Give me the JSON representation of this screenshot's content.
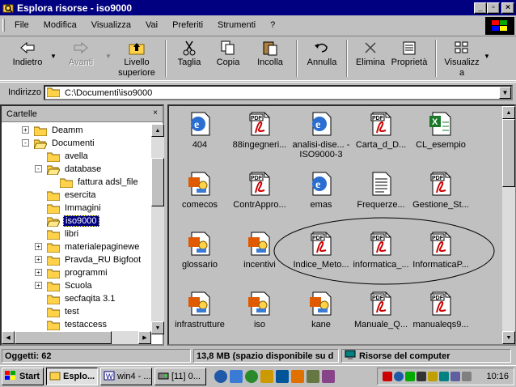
{
  "window": {
    "title": "Esplora risorse - iso9000"
  },
  "menu": [
    "File",
    "Modifica",
    "Visualizza",
    "Vai",
    "Preferiti",
    "Strumenti",
    "?"
  ],
  "toolbar": {
    "back": "Indietro",
    "forward": "Avanti",
    "up_line1": "Livello",
    "up_line2": "superiore",
    "cut": "Taglia",
    "copy": "Copia",
    "paste": "Incolla",
    "undo": "Annulla",
    "delete": "Elimina",
    "properties": "Proprietà",
    "views_line1": "Visualizz",
    "views_line2": "a"
  },
  "address": {
    "label": "Indirizzo",
    "value": "C:\\Documenti\\iso9000"
  },
  "folders_pane": {
    "title": "Cartelle",
    "close": "×"
  },
  "tree": [
    {
      "label": "Deamm",
      "level": 2,
      "expander": "+"
    },
    {
      "label": "Documenti",
      "level": 2,
      "expander": "-"
    },
    {
      "label": "avella",
      "level": 3,
      "expander": ""
    },
    {
      "label": "database",
      "level": 3,
      "expander": "-"
    },
    {
      "label": "fattura adsl_file",
      "level": 4,
      "expander": ""
    },
    {
      "label": "esercita",
      "level": 3,
      "expander": ""
    },
    {
      "label": "Immagini",
      "level": 3,
      "expander": ""
    },
    {
      "label": "iso9000",
      "level": 3,
      "expander": "",
      "selected": true
    },
    {
      "label": "libri",
      "level": 3,
      "expander": ""
    },
    {
      "label": "materialepaginewe",
      "level": 3,
      "expander": "+"
    },
    {
      "label": "Pravda_RU Bigfoot",
      "level": 3,
      "expander": "+"
    },
    {
      "label": "programmi",
      "level": 3,
      "expander": "+"
    },
    {
      "label": "Scuola",
      "level": 3,
      "expander": "+"
    },
    {
      "label": "secfaqita 3.1",
      "level": 3,
      "expander": ""
    },
    {
      "label": "test",
      "level": 3,
      "expander": ""
    },
    {
      "label": "testaccess",
      "level": 3,
      "expander": ""
    }
  ],
  "files": [
    {
      "name": "404",
      "icon": "ie-html-icon"
    },
    {
      "name": "88ingegneri...",
      "icon": "pdf-icon"
    },
    {
      "name": "analisi-dise... - ISO9000-3",
      "icon": "ie-html-icon"
    },
    {
      "name": "Carta_d_D...",
      "icon": "pdf-icon"
    },
    {
      "name": "CL_esempio",
      "icon": "excel-icon"
    },
    {
      "name": "comecos",
      "icon": "powerpoint-icon"
    },
    {
      "name": "ContrAppro...",
      "icon": "pdf-icon"
    },
    {
      "name": "emas",
      "icon": "ie-html-icon"
    },
    {
      "name": "Frequerze...",
      "icon": "text-document-icon"
    },
    {
      "name": "Gestione_St...",
      "icon": "pdf-icon"
    },
    {
      "name": "glossario",
      "icon": "powerpoint-icon"
    },
    {
      "name": "incentivi",
      "icon": "powerpoint-icon"
    },
    {
      "name": "Indice_Meto...",
      "icon": "pdf-icon"
    },
    {
      "name": "informatica_...",
      "icon": "pdf-icon"
    },
    {
      "name": "InformaticaP...",
      "icon": "pdf-icon"
    },
    {
      "name": "infrastrutture",
      "icon": "powerpoint-icon"
    },
    {
      "name": "iso",
      "icon": "powerpoint-icon"
    },
    {
      "name": "kane",
      "icon": "powerpoint-icon"
    },
    {
      "name": "Manuale_Q...",
      "icon": "pdf-icon"
    },
    {
      "name": "manualeqs9...",
      "icon": "pdf-icon"
    }
  ],
  "pdf_badge": "PDF",
  "status": {
    "objects": "Oggetti: 62",
    "size": "13,8 MB (spazio disponibile su d",
    "location": "Risorse del computer"
  },
  "taskbar": {
    "start": "Start",
    "tasks": [
      "Esplo...",
      "win4 - ...",
      "[11] 0..."
    ],
    "clock": "10:16"
  },
  "colors": {
    "titlebar": "#000080",
    "selection": "#000080",
    "desktop_gray": "#c0c0c0",
    "pdf_red": "#cc0000",
    "folder": "#ffd24a"
  }
}
